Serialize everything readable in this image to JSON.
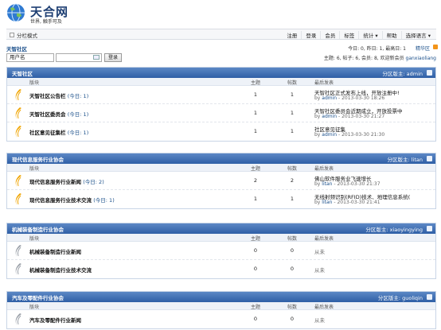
{
  "header": {
    "site_name": "天合网",
    "slogan": "世界, 触手可及"
  },
  "topbar": {
    "view_mode": "分栏模式",
    "nav": [
      "注册",
      "登录",
      "会员",
      "标签",
      "统计 ▾",
      "帮助",
      "选择语言 ▾"
    ]
  },
  "login": {
    "community_name": "天智社区",
    "username_label": "用户名",
    "login_button": "登录"
  },
  "stats": {
    "today": "今日: 0, 昨日: 1, 最高日: 1",
    "highlight": "精华区",
    "members_prefix": "主题: 6, 帖子: 6, 会员: 8, 欢迎新会员",
    "newest_member": "ganxiaoliang"
  },
  "columns": {
    "forum": "版块",
    "topics": "主题",
    "posts": "帖数",
    "last": "最后发表"
  },
  "categories": [
    {
      "title": "天智社区",
      "moderator": "分区版主: admin",
      "forums": [
        {
          "name": "天智社区公告栏",
          "today": "(今日: 1)",
          "topics": "1",
          "posts": "1",
          "last_title": "天智社区正式发布上线，开放注册中!",
          "last_by": "admin",
          "last_time": "2013-03-30 18:26",
          "icon_color": "#f0a400"
        },
        {
          "name": "天智社区委员会",
          "today": "(今日: 1)",
          "topics": "1",
          "posts": "1",
          "last_title": "天智社区委员会近期成立，开放投票中",
          "last_by": "admin",
          "last_time": "2013-03-30 21:27",
          "icon_color": "#f0a400"
        },
        {
          "name": "社区意见征集栏",
          "today": "(今日: 1)",
          "topics": "1",
          "posts": "1",
          "last_title": "社区意见征集",
          "last_by": "admin",
          "last_time": "2013-03-30 21:30",
          "icon_color": "#f0a400"
        }
      ]
    },
    {
      "title": "现代信息服务行业协会",
      "moderator": "分区版主: litan",
      "forums": [
        {
          "name": "现代信息服务行业新闻",
          "today": "(今日: 2)",
          "topics": "2",
          "posts": "2",
          "last_title": "佛山软件服务业飞速增长",
          "last_by": "litan",
          "last_time": "2013-03-30 21:37",
          "icon_color": "#f0a400"
        },
        {
          "name": "现代信息服务行业技术交流",
          "today": "(今日: 1)",
          "topics": "1",
          "posts": "1",
          "last_title": "无线射频识别(RFID)技术、地理信息系统(",
          "last_by": "litan",
          "last_time": "2013-03-30 21:41",
          "icon_color": "#f0a400"
        }
      ]
    },
    {
      "title": "机械装备制造行业协会",
      "moderator": "分区版主: xiaoyingying",
      "forums": [
        {
          "name": "机械装备制造行业新闻",
          "today": "",
          "topics": "0",
          "posts": "0",
          "never": "从未",
          "icon_color": "#9aa0a8"
        },
        {
          "name": "机械装备制造行业技术交流",
          "today": "",
          "topics": "0",
          "posts": "0",
          "never": "从未",
          "icon_color": "#9aa0a8"
        }
      ]
    },
    {
      "title": "汽车及零配件行业协会",
      "moderator": "分区版主: guoliqin",
      "forums": [
        {
          "name": "汽车及零配件行业新闻",
          "today": "",
          "topics": "0",
          "posts": "0",
          "never": "从未",
          "icon_color": "#9aa0a8"
        }
      ]
    }
  ]
}
